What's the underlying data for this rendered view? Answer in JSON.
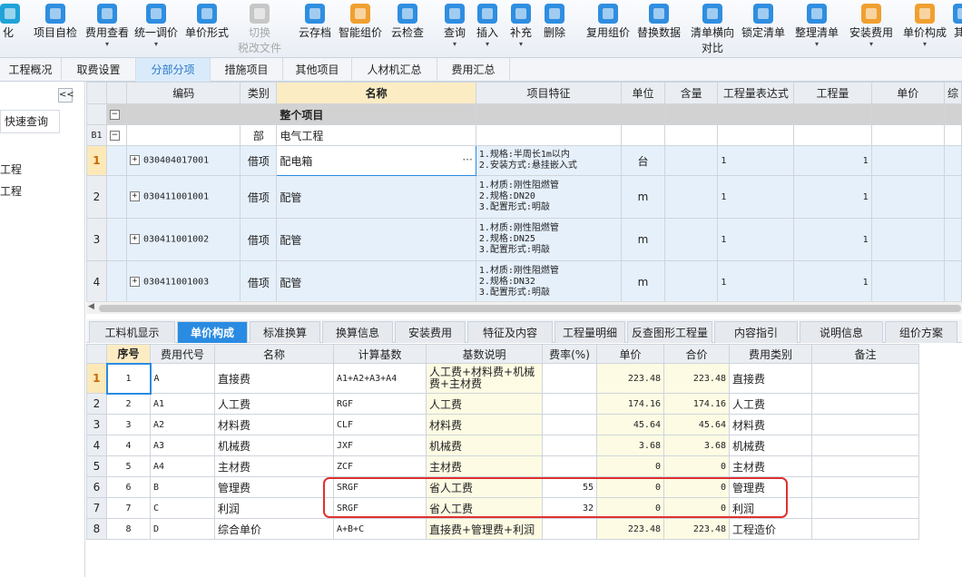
{
  "toolbar": {
    "items": [
      {
        "label": "化",
        "icon": "optimize-icon"
      },
      {
        "label": "项目自检",
        "icon": "self-check-icon"
      },
      {
        "label": "费用查看",
        "icon": "cost-view-icon"
      },
      {
        "label": "统一调价",
        "icon": "price-adjust-icon"
      },
      {
        "label": "单价形式",
        "icon": "price-form-icon"
      },
      {
        "label": "切换",
        "label2": "税改文件",
        "icon": "switch-file-icon",
        "disabled": true
      },
      {
        "label": "云存档",
        "icon": "cloud-save-icon"
      },
      {
        "label": "智能组价",
        "icon": "smart-price-icon"
      },
      {
        "label": "云检查",
        "icon": "cloud-check-icon"
      },
      {
        "label": "查询",
        "icon": "query-icon"
      },
      {
        "label": "插入",
        "icon": "insert-icon"
      },
      {
        "label": "补充",
        "icon": "supplement-icon"
      },
      {
        "label": "删除",
        "icon": "delete-icon"
      },
      {
        "label": "复用组价",
        "icon": "reuse-price-icon"
      },
      {
        "label": "替换数据",
        "icon": "replace-data-icon"
      },
      {
        "label": "清单横向",
        "label2": "对比",
        "icon": "list-compare-icon"
      },
      {
        "label": "锁定清单",
        "icon": "lock-list-icon"
      },
      {
        "label": "整理清单",
        "icon": "organize-list-icon"
      },
      {
        "label": "安装费用",
        "icon": "install-cost-icon"
      },
      {
        "label": "单价构成",
        "icon": "price-composition-icon"
      },
      {
        "label": "其",
        "icon": "other-icon"
      }
    ]
  },
  "nav_tabs": [
    "工程概况",
    "取费设置",
    "分部分项",
    "措施项目",
    "其他项目",
    "人材机汇总",
    "费用汇总"
  ],
  "left_panel": {
    "collapse": "<<",
    "quick_search": "快速查询",
    "items": [
      "工程",
      "工程"
    ]
  },
  "upper_table": {
    "headers": [
      "编码",
      "类别",
      "名称",
      "项目特征",
      "单位",
      "含量",
      "工程量表达式",
      "工程量",
      "单价",
      "综"
    ],
    "whole_project": "整个项目",
    "section": {
      "rownum": "B1",
      "type": "部",
      "name": "电气工程"
    },
    "rows": [
      {
        "num": "1",
        "code": "030404017001",
        "type": "借项",
        "name": "配电箱",
        "feature": "1.规格:半周长1m以内\n2.安装方式:悬挂嵌入式",
        "unit": "台",
        "expr": "1",
        "qty": "1"
      },
      {
        "num": "2",
        "code": "030411001001",
        "type": "借项",
        "name": "配管",
        "feature": "1.材质:刚性阻燃管\n2.规格:DN20\n3.配置形式:明敲",
        "unit": "m",
        "expr": "1",
        "qty": "1"
      },
      {
        "num": "3",
        "code": "030411001002",
        "type": "借项",
        "name": "配管",
        "feature": "1.材质:刚性阻燃管\n2.规格:DN25\n3.配置形式:明敲",
        "unit": "m",
        "expr": "1",
        "qty": "1"
      },
      {
        "num": "4",
        "code": "030411001003",
        "type": "借项",
        "name": "配管",
        "feature": "1.材质:刚性阻燃管\n2.规格:DN32\n3.配置形式:明敲",
        "unit": "m",
        "expr": "1",
        "qty": "1"
      }
    ],
    "ellipsis": "···"
  },
  "bottom_tabs": [
    "工料机显示",
    "单价构成",
    "标准换算",
    "换算信息",
    "安装费用",
    "特征及内容",
    "工程量明细",
    "反查图形工程量",
    "内容指引",
    "说明信息",
    "组价方案"
  ],
  "lower_table": {
    "headers": [
      "序号",
      "费用代号",
      "名称",
      "计算基数",
      "基数说明",
      "费率(%)",
      "单价",
      "合价",
      "费用类别",
      "备注"
    ],
    "rows": [
      {
        "n": "1",
        "seq": "1",
        "code": "A",
        "name": "直接费",
        "base": "A1+A2+A3+A4",
        "desc": "人工费+材料费+机械费+主材费",
        "rate": "",
        "price": "223.48",
        "total": "223.48",
        "cat": "直接费"
      },
      {
        "n": "2",
        "seq": "2",
        "code": "A1",
        "name": "人工费",
        "base": "RGF",
        "desc": "人工费",
        "rate": "",
        "price": "174.16",
        "total": "174.16",
        "cat": "人工费"
      },
      {
        "n": "3",
        "seq": "3",
        "code": "A2",
        "name": "材料费",
        "base": "CLF",
        "desc": "材料费",
        "rate": "",
        "price": "45.64",
        "total": "45.64",
        "cat": "材料费"
      },
      {
        "n": "4",
        "seq": "4",
        "code": "A3",
        "name": "机械费",
        "base": "JXF",
        "desc": "机械费",
        "rate": "",
        "price": "3.68",
        "total": "3.68",
        "cat": "机械费"
      },
      {
        "n": "5",
        "seq": "5",
        "code": "A4",
        "name": "主材费",
        "base": "ZCF",
        "desc": "主材费",
        "rate": "",
        "price": "0",
        "total": "0",
        "cat": "主材费"
      },
      {
        "n": "6",
        "seq": "6",
        "code": "B",
        "name": "管理费",
        "base": "SRGF",
        "desc": "省人工费",
        "rate": "55",
        "price": "0",
        "total": "0",
        "cat": "管理费"
      },
      {
        "n": "7",
        "seq": "7",
        "code": "C",
        "name": "利润",
        "base": "SRGF",
        "desc": "省人工费",
        "rate": "32",
        "price": "0",
        "total": "0",
        "cat": "利润"
      },
      {
        "n": "8",
        "seq": "8",
        "code": "D",
        "name": "综合单价",
        "base": "A+B+C",
        "desc": "直接费+管理费+利润",
        "rate": "",
        "price": "223.48",
        "total": "223.48",
        "cat": "工程造价"
      }
    ]
  },
  "colors": {
    "accent": "#2a8be2",
    "highlight_box": "#e03030",
    "header_highlight": "#fcecc4"
  }
}
